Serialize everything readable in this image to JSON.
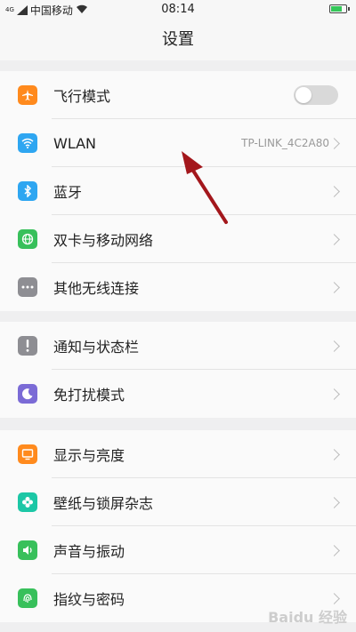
{
  "status_bar": {
    "net_type": "4G",
    "carrier": "中国移动",
    "time": "08:14",
    "battery_icon": "battery-charging-icon"
  },
  "header": {
    "title": "设置"
  },
  "groups": [
    {
      "items": [
        {
          "label": "飞行模式",
          "icon": "airplane-icon",
          "color": "#ff8a1d",
          "control": "toggle",
          "toggle_on": false
        },
        {
          "label": "WLAN",
          "icon": "wifi-icon",
          "color": "#2ea6f1",
          "value": "TP-LINK_4C2A80"
        },
        {
          "label": "蓝牙",
          "icon": "bluetooth-icon",
          "color": "#2ea6f1"
        },
        {
          "label": "双卡与移动网络",
          "icon": "globe-icon",
          "color": "#38c05b"
        },
        {
          "label": "其他无线连接",
          "icon": "more-dots-icon",
          "color": "#8e8e93"
        }
      ]
    },
    {
      "items": [
        {
          "label": "通知与状态栏",
          "icon": "exclamation-icon",
          "color": "#8e8e93"
        },
        {
          "label": "免打扰模式",
          "icon": "moon-icon",
          "color": "#7b6bd6"
        }
      ]
    },
    {
      "items": [
        {
          "label": "显示与亮度",
          "icon": "display-icon",
          "color": "#ff8a1d"
        },
        {
          "label": "壁纸与锁屏杂志",
          "icon": "flower-icon",
          "color": "#1cc7a6"
        },
        {
          "label": "声音与振动",
          "icon": "speaker-icon",
          "color": "#38c05b"
        },
        {
          "label": "指纹与密码",
          "icon": "fingerprint-icon",
          "color": "#38c05b"
        }
      ]
    }
  ],
  "annotation": {
    "arrow_color": "#a3171c"
  },
  "watermark": "Baidu 经验"
}
